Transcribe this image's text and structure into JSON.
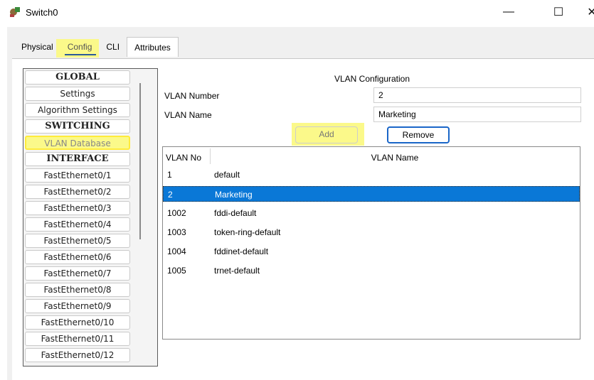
{
  "window": {
    "title": "Switch0",
    "minimize_glyph": "—",
    "maximize_glyph": "☐",
    "close_glyph": "✕"
  },
  "tabs": [
    {
      "label": "Physical"
    },
    {
      "label": "Config"
    },
    {
      "label": "CLI"
    },
    {
      "label": "Attributes"
    }
  ],
  "sidebar": {
    "items": [
      {
        "label": "GLOBAL",
        "type": "header"
      },
      {
        "label": "Settings",
        "type": "item"
      },
      {
        "label": "Algorithm Settings",
        "type": "item"
      },
      {
        "label": "SWITCHING",
        "type": "header"
      },
      {
        "label": "VLAN Database",
        "type": "selected"
      },
      {
        "label": "INTERFACE",
        "type": "header"
      },
      {
        "label": "FastEthernet0/1",
        "type": "item"
      },
      {
        "label": "FastEthernet0/2",
        "type": "item"
      },
      {
        "label": "FastEthernet0/3",
        "type": "item"
      },
      {
        "label": "FastEthernet0/4",
        "type": "item"
      },
      {
        "label": "FastEthernet0/5",
        "type": "item"
      },
      {
        "label": "FastEthernet0/6",
        "type": "item"
      },
      {
        "label": "FastEthernet0/7",
        "type": "item"
      },
      {
        "label": "FastEthernet0/8",
        "type": "item"
      },
      {
        "label": "FastEthernet0/9",
        "type": "item"
      },
      {
        "label": "FastEthernet0/10",
        "type": "item"
      },
      {
        "label": "FastEthernet0/11",
        "type": "item"
      },
      {
        "label": "FastEthernet0/12",
        "type": "item"
      }
    ]
  },
  "vlan_config": {
    "heading": "VLAN Configuration",
    "number_label": "VLAN Number",
    "number_value": "2",
    "name_label": "VLAN Name",
    "name_value": "Marketing",
    "add_label": "Add",
    "remove_label": "Remove"
  },
  "table": {
    "col_no": "VLAN No",
    "col_name": "VLAN Name",
    "rows": [
      {
        "no": "1",
        "name": "default",
        "selected": false
      },
      {
        "no": "2",
        "name": "Marketing",
        "selected": true
      },
      {
        "no": "1002",
        "name": "fddi-default",
        "selected": false
      },
      {
        "no": "1003",
        "name": "token-ring-default",
        "selected": false
      },
      {
        "no": "1004",
        "name": "fddinet-default",
        "selected": false
      },
      {
        "no": "1005",
        "name": "trnet-default",
        "selected": false
      }
    ]
  },
  "colors": {
    "highlight": "#fbf98a",
    "selection": "#0a78d7",
    "accent": "#1a66c8"
  }
}
